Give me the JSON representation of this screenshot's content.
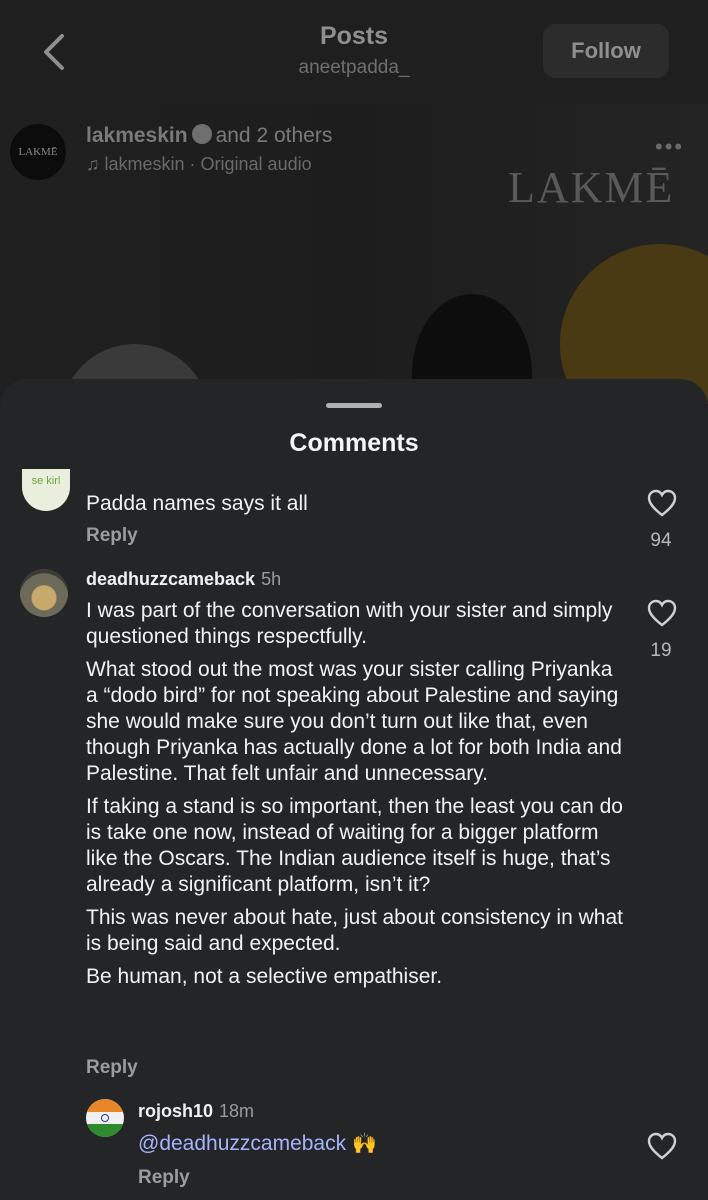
{
  "header": {
    "title": "Posts",
    "subtitle": "aneetpadda_",
    "follow_label": "Follow",
    "back_icon": "chevron-left-icon"
  },
  "post": {
    "avatar_text": "LAKMĒ",
    "username": "lakmeskin",
    "others": "and 2 others",
    "audio": "lakmeskin · Original audio",
    "brand_text": "LAKMĒ",
    "more_icon": "more-dots-icon"
  },
  "sheet": {
    "title": "Comments",
    "comments": [
      {
        "text": "Padda names says it all",
        "reply_label": "Reply",
        "likes": "94"
      },
      {
        "username": "deadhuzzcameback",
        "time": "5h",
        "paragraphs": [
          "I was part of the conversation with your sister and simply questioned things respectfully.",
          "What stood out the most was your sister calling Priyanka a “dodo bird” for not speaking about Palestine and saying she would make sure you don’t turn out like that, even though Priyanka has actually done a lot for both India and Palestine. That felt unfair and unnecessary.",
          "If taking a stand is so important, then the least you can do is take one now, instead of waiting for a bigger platform like the Oscars. The Indian audience itself is huge, that’s already a significant platform, isn’t it?",
          "This was never about hate, just about consistency in what is being said and expected.",
          "Be human, not a selective empathiser."
        ],
        "reply_label": "Reply",
        "likes": "19"
      },
      {
        "username": "rojosh10",
        "time": "18m",
        "mention": "@deadhuzzcameback",
        "emoji": "🙌",
        "reply_label": "Reply"
      }
    ]
  },
  "colors": {
    "sheet_bg": "#232527",
    "mention": "#a6b4ff",
    "muted": "#9c9c9c"
  }
}
